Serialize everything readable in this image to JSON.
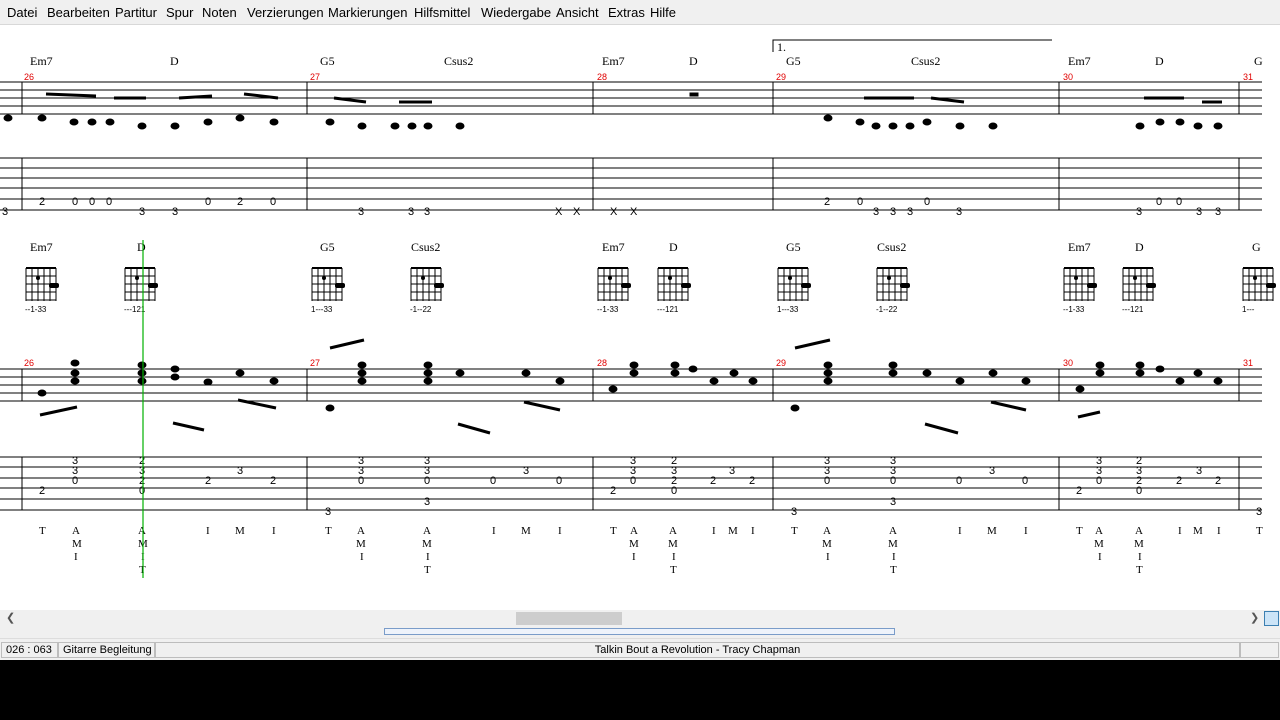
{
  "menu": [
    "Datei",
    "Bearbeiten",
    "Partitur",
    "Spur",
    "Noten",
    "Verzierungen",
    "Markierungen",
    "Hilfsmittel",
    "Wiedergabe",
    "Ansicht",
    "Extras",
    "Hilfe"
  ],
  "volta": "1.",
  "top_chords": [
    "Em7",
    "D",
    "G5",
    "Csus2",
    "Em7",
    "D",
    "G5",
    "Csus2",
    "Em7",
    "D",
    "G"
  ],
  "bar_numbers": [
    "26",
    "27",
    "28",
    "29",
    "30",
    "31"
  ],
  "diag_chords": [
    "Em7",
    "D",
    "G5",
    "Csus2",
    "Em7",
    "D",
    "G5",
    "Csus2",
    "Em7",
    "D",
    "G"
  ],
  "diag_fingerings": [
    "--1-33",
    "---121",
    "1---33",
    "-1--22",
    "--1-33",
    "---121",
    "1---33",
    "-1--22",
    "--1-33",
    "---121",
    "1---"
  ],
  "status": {
    "position": "026 : 063",
    "track": "Gitarre Begleitung",
    "song": "Talkin Bout a Revolution   - Tracy Chapman"
  },
  "colors": {
    "bar_number": "#e00000",
    "cursor": "#00b000"
  }
}
